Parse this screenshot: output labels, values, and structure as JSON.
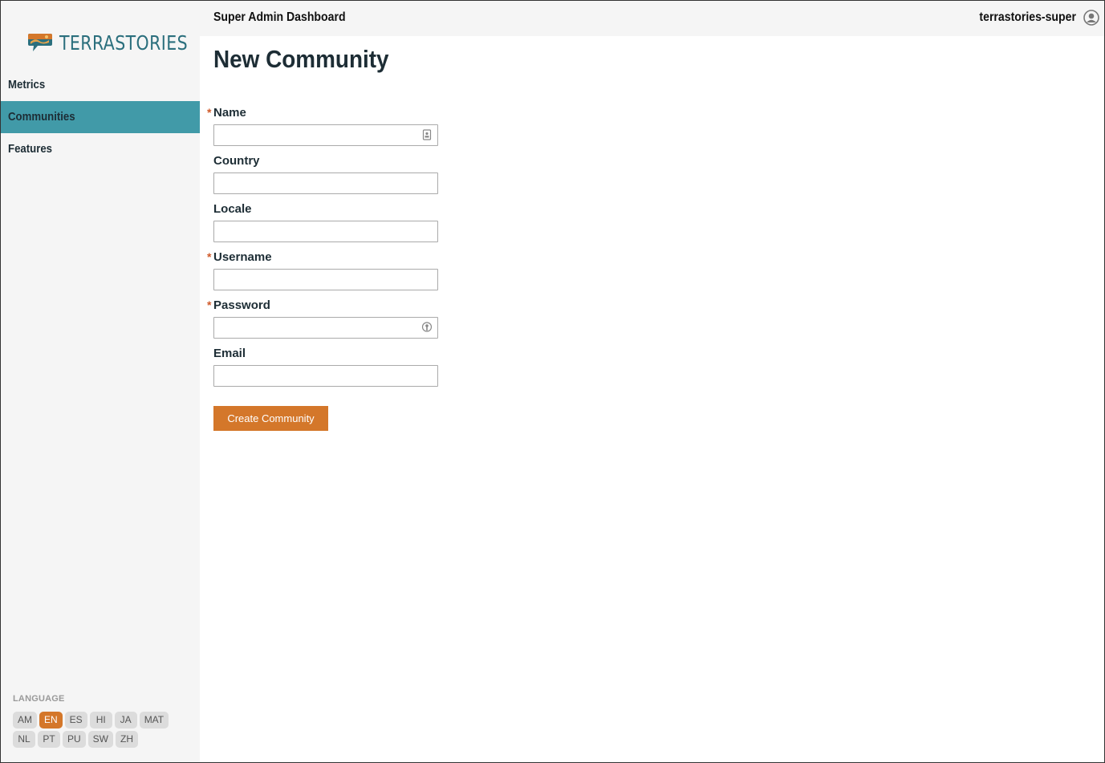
{
  "brand": {
    "name": "TERRASTORIES",
    "logo_icon": "terrastories-logo-icon"
  },
  "sidebar": {
    "items": [
      {
        "label": "Metrics",
        "active": false
      },
      {
        "label": "Communities",
        "active": true
      },
      {
        "label": "Features",
        "active": false
      }
    ],
    "active_color": "#419aa8"
  },
  "language": {
    "title": "LANGUAGE",
    "selected": "EN",
    "row1": [
      "AM",
      "EN",
      "ES",
      "HI",
      "JA",
      "MAT"
    ],
    "row2": [
      "NL",
      "PT",
      "PU",
      "SW",
      "ZH"
    ],
    "accent_color": "#d4772a"
  },
  "header": {
    "title": "Super Admin Dashboard",
    "user": "terrastories-super",
    "user_icon": "user-avatar-icon"
  },
  "page": {
    "title": "New Community",
    "fields": [
      {
        "label": "Name",
        "required": true,
        "value": "",
        "icon": "contact-card-icon"
      },
      {
        "label": "Country",
        "required": false,
        "value": ""
      },
      {
        "label": "Locale",
        "required": false,
        "value": ""
      },
      {
        "label": "Username",
        "required": true,
        "value": ""
      },
      {
        "label": "Password",
        "required": true,
        "value": "",
        "icon": "password-key-icon"
      },
      {
        "label": "Email",
        "required": false,
        "value": ""
      }
    ],
    "required_marker": "*",
    "submit_label": "Create Community",
    "submit_color": "#d4772a"
  }
}
